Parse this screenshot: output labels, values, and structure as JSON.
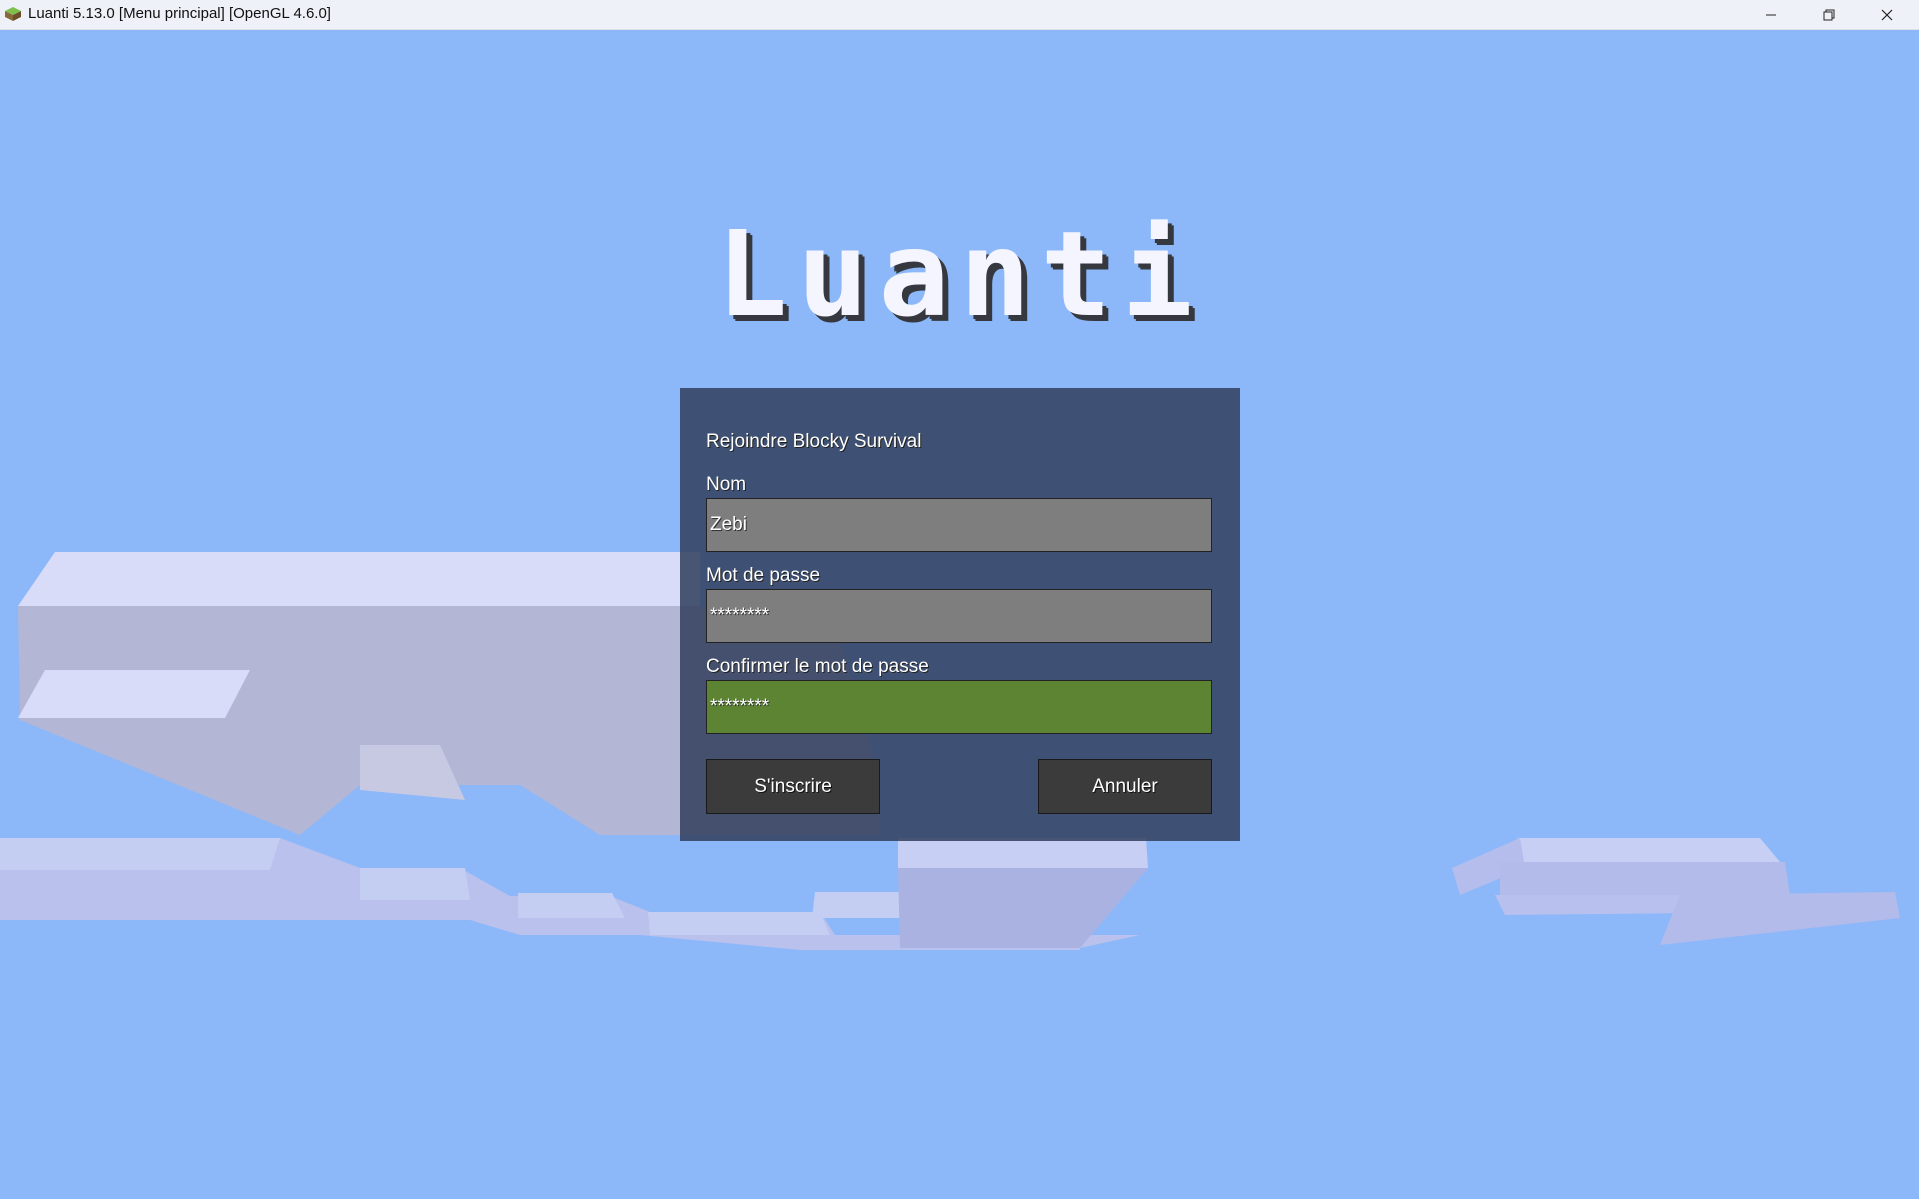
{
  "window": {
    "title": "Luanti 5.13.0 [Menu principal] [OpenGL 4.6.0]",
    "controls": [
      "minimize-icon",
      "restore-icon",
      "close-icon"
    ]
  },
  "logo": {
    "text": "Luanti"
  },
  "dialog": {
    "title": "Rejoindre Blocky Survival",
    "name_label": "Nom",
    "name_value": "Zebi",
    "password_label": "Mot de passe",
    "password_value": "********",
    "confirm_label": "Confirmer le mot de passe",
    "confirm_value": "********",
    "register_button": "S'inscrire",
    "cancel_button": "Annuler"
  },
  "colors": {
    "sky": "#8cb8fa",
    "dialog_bg": "#303e5c",
    "field_bg": "#7e7e7e",
    "field_active_bg": "#5c8433",
    "button_bg": "#3b3b3b"
  }
}
